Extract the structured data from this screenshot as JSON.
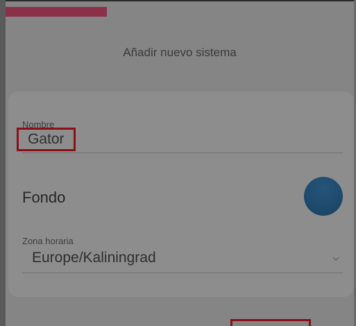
{
  "dialog": {
    "title": "Añadir nuevo sistema"
  },
  "progress": {
    "fraction": 0.29,
    "color": "#8c2f48"
  },
  "form": {
    "name": {
      "label": "Nombre",
      "value": "Gator"
    },
    "background": {
      "label": "Fondo",
      "swatch_color": "#1d4a6c"
    },
    "timezone": {
      "label": "Zona horaria",
      "value": "Europe/Kaliningrad",
      "icon": "chevron-down-icon"
    }
  },
  "colors": {
    "overlay": "#858585",
    "card": "#8d8d8d",
    "highlight": "#8b0f17"
  }
}
